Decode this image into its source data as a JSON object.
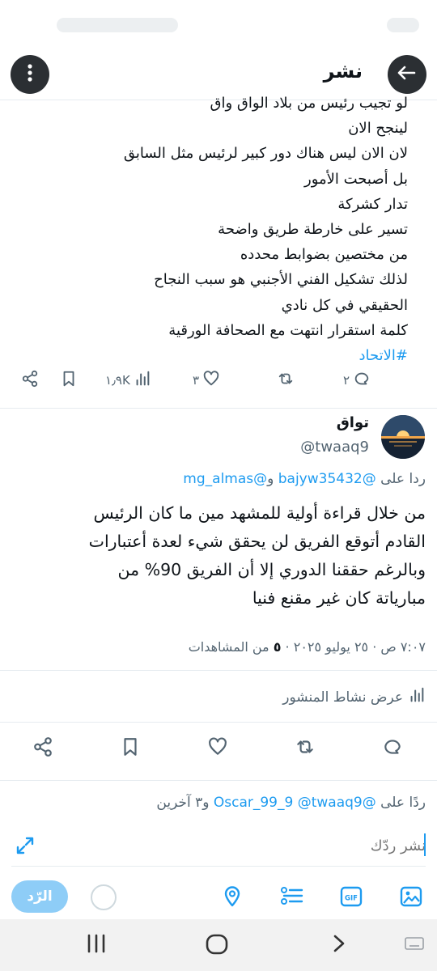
{
  "topbar": {
    "title": "نشر"
  },
  "tweet1": {
    "lines": [
      "لو تجيب رئيس من بلاد الواق واق",
      "لينجح الان",
      "لان الان ليس هناك دور كبير لرئيس مثل السابق",
      "بل أصبحت الأمور",
      "تدار كشركة",
      "تسير على خارطة طريق واضحة",
      "من مختصين بضوابط محدده",
      "لذلك تشكيل الفني الأجنبي هو سبب النجاح",
      "الحقيقي في كل نادي",
      "كلمة استقرار انتهت مع الصحافة الورقية"
    ],
    "hashtag": "#الاتحاد",
    "replies": "٢",
    "likes": "٣",
    "views": "١٫٩K"
  },
  "tweet2": {
    "author_name": "تواق",
    "author_handle": "@twaaq9",
    "reply_prefix": "ردا على ",
    "mention1": "@bajyw35432",
    "and_word": " و",
    "mention2": "@mg_almas",
    "lines": [
      "من خلال قراءة أولية للمشهد مين ما كان الرئيس",
      "القادم أتوقع الفريق لن يحقق شيء لعدة أعتبارات",
      "وبالرغم حققنا الدوري إلا أن الفريق 90% من",
      "مبارياتة كان غير مقنع فنيا"
    ],
    "time_date": "٧:٠٧ ص · ٢٥ يوليو ٢٠٢٥ · ",
    "views_count": "٥",
    "views_label": " من المشاهدات",
    "activity_label": "عرض نشاط المنشور"
  },
  "composer": {
    "replying_prefix": "ردًا على ",
    "mention1": "@Oscar_99_9",
    "mention2": "@twaaq9",
    "others": " و٣ آخرين",
    "placeholder": "نشر ردّك",
    "reply_button": "الرّد"
  },
  "colors": {
    "accent": "#1d9bf0",
    "text": "#0f1419",
    "muted": "#536471"
  }
}
